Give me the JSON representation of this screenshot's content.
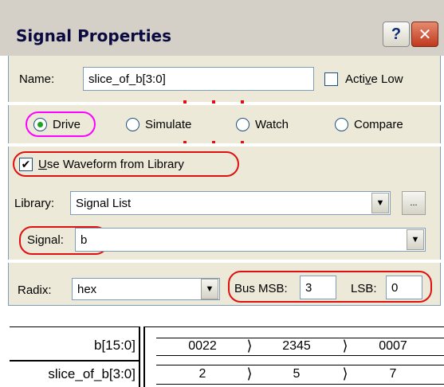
{
  "window": {
    "title": "Signal Properties",
    "help_label": "?",
    "close_label": "✕"
  },
  "name_row": {
    "label": "Name:",
    "value": "slice_of_b[3:0]",
    "active_low_label": "Active Low",
    "active_low_checked": false
  },
  "mode": {
    "options": [
      "Drive",
      "Simulate",
      "Watch",
      "Compare"
    ],
    "selected": "Drive"
  },
  "use_waveform": {
    "label": "Use Waveform from Library",
    "checked": true
  },
  "library": {
    "label": "Library:",
    "value": "Signal List",
    "browse_label": "..."
  },
  "signal": {
    "label": "Signal:",
    "value": "b"
  },
  "radix": {
    "label": "Radix:",
    "value": "hex",
    "bus_msb_label": "Bus MSB:",
    "bus_msb_value": "3",
    "lsb_label": "LSB:",
    "lsb_value": "0"
  },
  "waveform": {
    "rows": [
      {
        "name": "b[15:0]",
        "values": [
          "0022",
          "2345",
          "0007"
        ]
      },
      {
        "name": "slice_of_b[3:0]",
        "values": [
          "2",
          "5",
          "7"
        ]
      }
    ]
  },
  "colors": {
    "dialog_face": "#ece9d8",
    "annotation_red": "#e01010",
    "radio_dot": "#21a121"
  }
}
